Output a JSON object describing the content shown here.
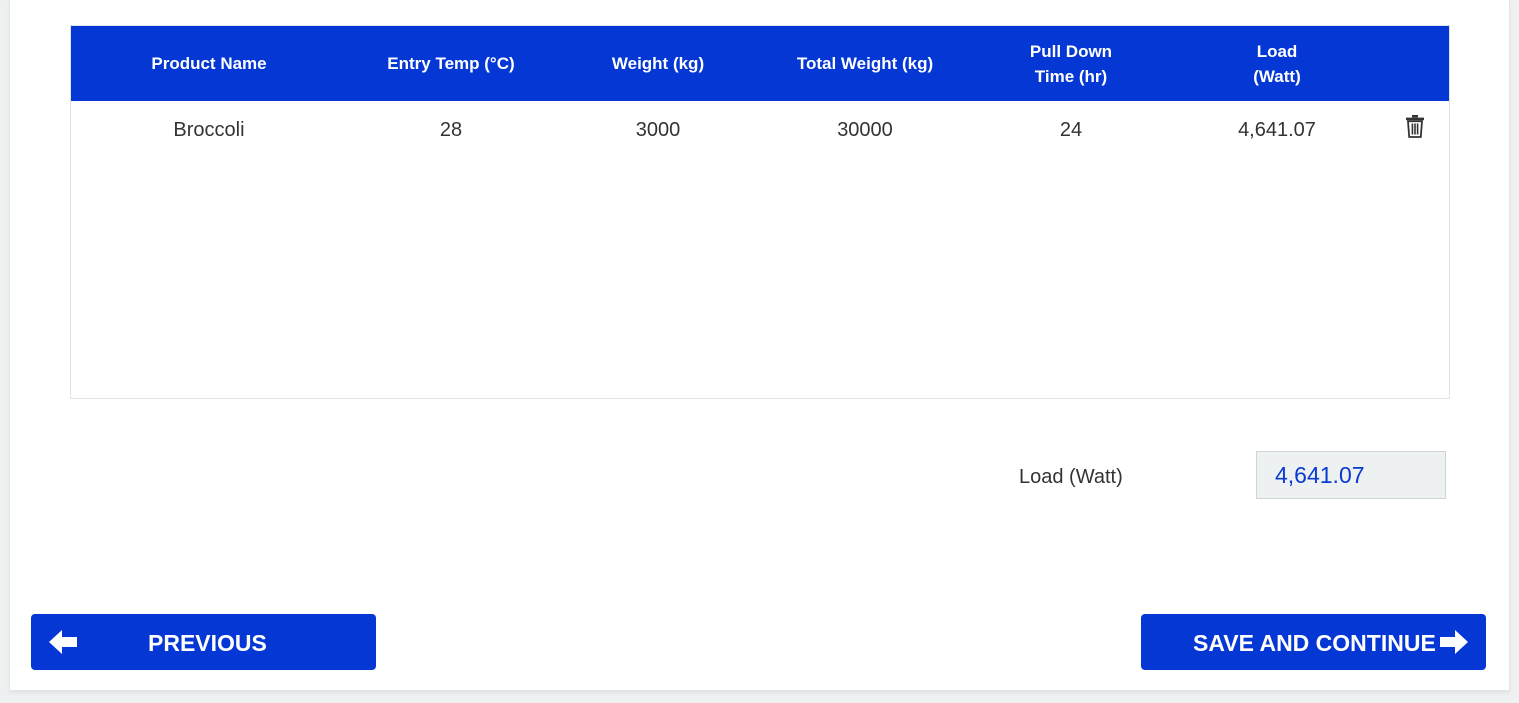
{
  "table": {
    "headers": [
      "Product Name",
      "Entry Temp (°C)",
      "Weight (kg)",
      "Total Weight (kg)",
      "Pull Down\nTime (hr)",
      "Load\n(Watt)"
    ],
    "rows": [
      {
        "product_name": "Broccoli",
        "entry_temp": "28",
        "weight": "3000",
        "total_weight": "30000",
        "pull_down_time": "24",
        "load": "4,641.07",
        "delete_icon": "trash-icon"
      }
    ]
  },
  "summary": {
    "load_label": "Load (Watt)",
    "load_value": "4,641.07"
  },
  "buttons": {
    "previous_label": "PREVIOUS",
    "previous_icon": "arrow-left-icon",
    "save_continue_label": "SAVE AND CONTINUE",
    "save_continue_icon": "arrow-right-icon"
  },
  "colors": {
    "accent": "#0537d5",
    "value_text": "#0a3bd0",
    "body_text": "#333333"
  }
}
